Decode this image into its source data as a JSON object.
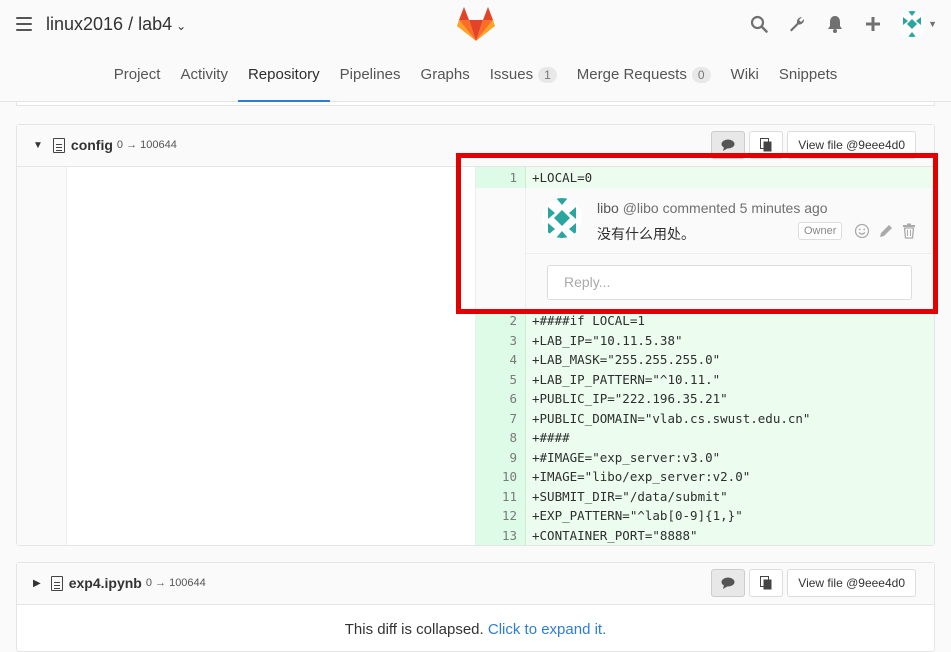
{
  "header": {
    "project_path": "linux2016 / lab4",
    "icons": [
      "hamburger-icon",
      "gitlab-logo",
      "search-icon",
      "wrench-icon",
      "bell-icon",
      "plus-icon",
      "user-avatar"
    ]
  },
  "nav": {
    "tabs": [
      {
        "label": "Project"
      },
      {
        "label": "Activity"
      },
      {
        "label": "Repository",
        "active": true
      },
      {
        "label": "Pipelines"
      },
      {
        "label": "Graphs"
      },
      {
        "label": "Issues",
        "badge": "1"
      },
      {
        "label": "Merge Requests",
        "badge": "0"
      },
      {
        "label": "Wiki"
      },
      {
        "label": "Snippets"
      }
    ]
  },
  "files": [
    {
      "name": "config",
      "mode": "0 → 100644",
      "view_file_label": "View file @9eee4d0",
      "first_line": {
        "num": "1",
        "code": "+LOCAL=0"
      },
      "note": {
        "author": "libo",
        "handle": "@libo",
        "action": "commented",
        "time": "5 minutes ago",
        "body": "没有什么用处。",
        "role": "Owner",
        "reply_placeholder": "Reply..."
      },
      "lines": [
        {
          "num": "2",
          "code": "+####if LOCAL=1"
        },
        {
          "num": "3",
          "code": "+LAB_IP=\"10.11.5.38\""
        },
        {
          "num": "4",
          "code": "+LAB_MASK=\"255.255.255.0\""
        },
        {
          "num": "5",
          "code": "+LAB_IP_PATTERN=\"^10.11.\""
        },
        {
          "num": "6",
          "code": "+PUBLIC_IP=\"222.196.35.21\""
        },
        {
          "num": "7",
          "code": "+PUBLIC_DOMAIN=\"vlab.cs.swust.edu.cn\""
        },
        {
          "num": "8",
          "code": "+####"
        },
        {
          "num": "9",
          "code": "+#IMAGE=\"exp_server:v3.0\""
        },
        {
          "num": "10",
          "code": "+IMAGE=\"libo/exp_server:v2.0\""
        },
        {
          "num": "11",
          "code": "+SUBMIT_DIR=\"/data/submit\""
        },
        {
          "num": "12",
          "code": "+EXP_PATTERN=\"^lab[0-9]{1,}\""
        },
        {
          "num": "13",
          "code": "+CONTAINER_PORT=\"8888\""
        }
      ]
    },
    {
      "name": "exp4.ipynb",
      "mode": "0 → 100644",
      "view_file_label": "View file @9eee4d0",
      "collapsed_text": "This diff is collapsed.",
      "expand_link": "Click to expand it."
    }
  ],
  "colors": {
    "accent": "#2e7ed6",
    "added_line_bg": "#ecfdf0",
    "added_num_bg": "#ddfbe6",
    "highlight": "#e30000"
  }
}
